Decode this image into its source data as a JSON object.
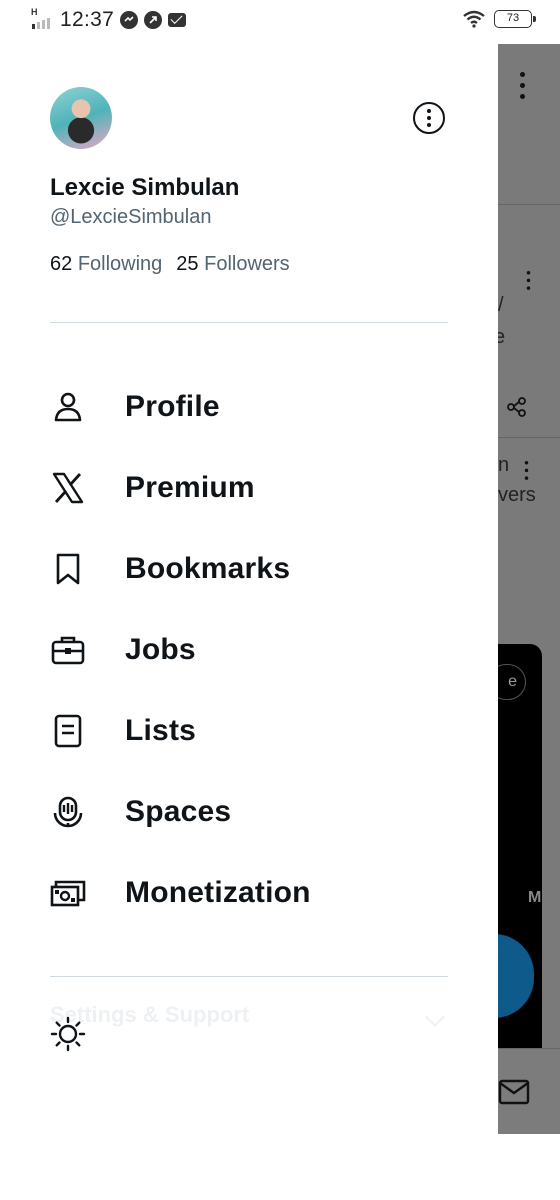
{
  "status_bar": {
    "time": "12:37",
    "network": "H",
    "battery": "73"
  },
  "profile": {
    "name": "Lexcie Simbulan",
    "handle": "@LexcieSimbulan",
    "following_count": "62",
    "following_label": "Following",
    "followers_count": "25",
    "followers_label": "Followers"
  },
  "menu": {
    "items": [
      {
        "label": "Profile",
        "icon": "person-icon"
      },
      {
        "label": "Premium",
        "icon": "x-logo-icon"
      },
      {
        "label": "Bookmarks",
        "icon": "bookmark-icon"
      },
      {
        "label": "Jobs",
        "icon": "briefcase-icon"
      },
      {
        "label": "Lists",
        "icon": "list-icon"
      },
      {
        "label": "Spaces",
        "icon": "spaces-icon"
      },
      {
        "label": "Monetization",
        "icon": "money-icon"
      }
    ]
  },
  "settings": {
    "label": "Settings & Support"
  },
  "background": {
    "text_1": "n",
    "text_2": "vers",
    "pill_text": "e",
    "tab_text": "M"
  }
}
